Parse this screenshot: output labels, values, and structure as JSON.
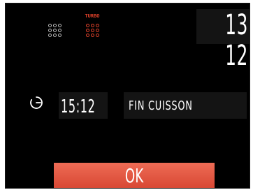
{
  "header": {
    "turbo_label": "TURBO",
    "clock": "13 12",
    "icons": [
      "burner-grid-icon",
      "turbo-burner-grid-icon"
    ]
  },
  "timer": {
    "icon": "timer-icon",
    "value": "15:12",
    "end_label": "FIN CUISSON"
  },
  "actions": {
    "ok_label": "OK"
  },
  "colors": {
    "background": "#000000",
    "panel": "#141414",
    "accent": "#e0412a",
    "button": "#e15a45",
    "text": "#ffffff",
    "icon_gray": "#b9b9b9"
  }
}
